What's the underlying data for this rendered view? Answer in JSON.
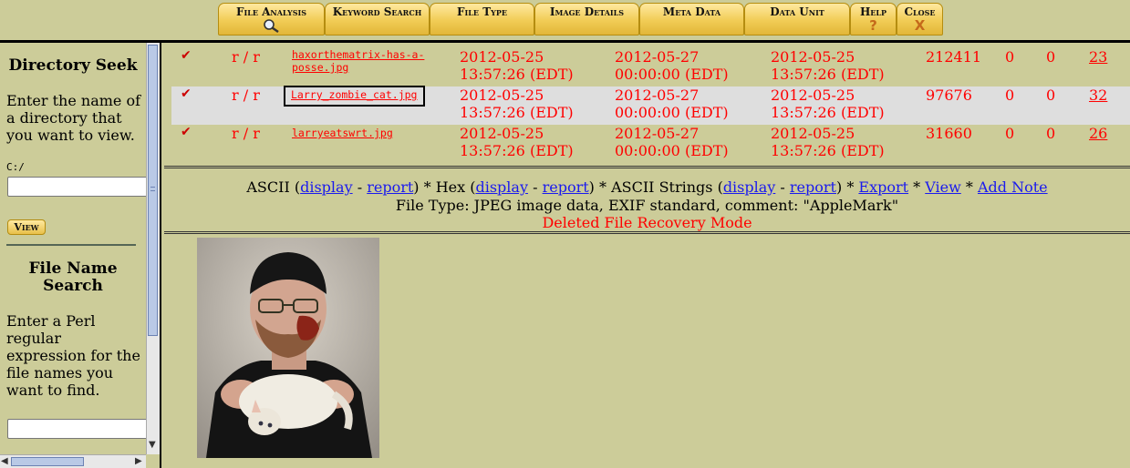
{
  "toolbar": {
    "tabs": [
      {
        "label": "File Analysis",
        "icon": "magnifier-icon"
      },
      {
        "label": "Keyword Search"
      },
      {
        "label": "File Type"
      },
      {
        "label": "Image Details"
      },
      {
        "label": "Meta Data"
      },
      {
        "label": "Data Unit"
      },
      {
        "label": "Help",
        "glyph": "?"
      },
      {
        "label": "Close",
        "glyph": "X"
      }
    ]
  },
  "sidebar": {
    "dir_title": "Directory Seek",
    "dir_desc": "Enter the name of a directory that you want to view.",
    "dir_value": "C:/",
    "view_label": "View",
    "fname_title": "File Name Search",
    "fname_desc": "Enter a Perl regular expression for the file names you want to find."
  },
  "files": [
    {
      "name": "haxorthematrix-has-a-posse.jpg",
      "type": "r / r",
      "written": "2012-05-25 13:57:26 (EDT)",
      "accessed": "2012-05-27 00:00:00 (EDT)",
      "created": "2012-05-25 13:57:26 (EDT)",
      "size": "212411",
      "uid": "0",
      "gid": "0",
      "meta": "23"
    },
    {
      "name": "Larry_zombie_cat.jpg",
      "type": "r / r",
      "written": "2012-05-25 13:57:26 (EDT)",
      "accessed": "2012-05-27 00:00:00 (EDT)",
      "created": "2012-05-25 13:57:26 (EDT)",
      "size": "97676",
      "uid": "0",
      "gid": "0",
      "meta": "32"
    },
    {
      "name": "larryeatswrt.jpg",
      "type": "r / r",
      "written": "2012-05-25 13:57:26 (EDT)",
      "accessed": "2012-05-27 00:00:00 (EDT)",
      "created": "2012-05-25 13:57:26 (EDT)",
      "size": "31660",
      "uid": "0",
      "gid": "0",
      "meta": "26"
    }
  ],
  "fileinfo": {
    "ascii": "ASCII",
    "hex": "Hex",
    "ascii_strings": "ASCII Strings",
    "display": "display",
    "report": "report",
    "export": "Export",
    "view": "View",
    "add_note": "Add Note",
    "filetype": "File Type: JPEG image data, EXIF standard, comment: \"AppleMark\"",
    "mode": "Deleted File Recovery Mode"
  },
  "colors": {
    "background": "#cccc99",
    "link": "#1a1aee",
    "deleted": "#ff0000",
    "tab": "#f1cc55"
  }
}
